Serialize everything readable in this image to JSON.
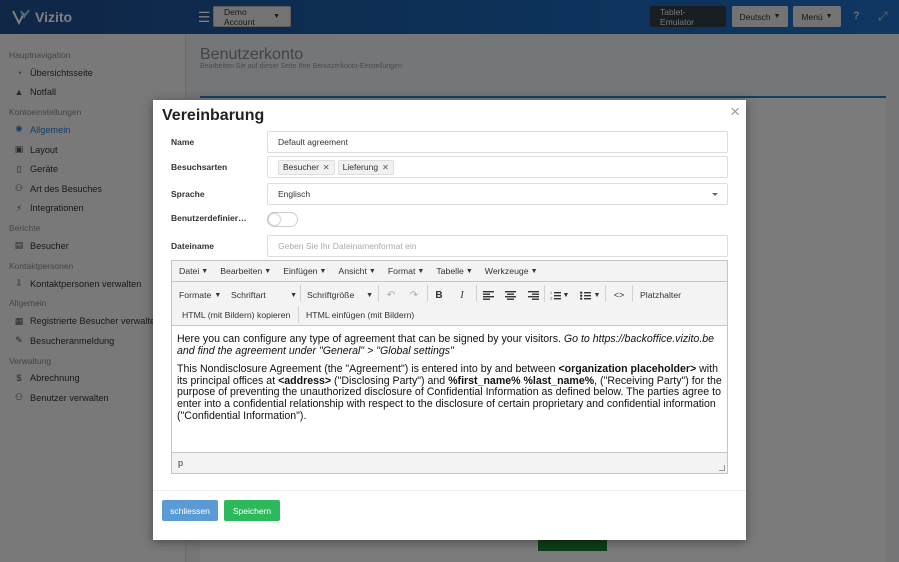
{
  "app": {
    "brand": "Vizito",
    "brand_icon": "vizito-logo-icon",
    "accent_color": "#1b64b5"
  },
  "topbar": {
    "account_label": "Demo Account",
    "tablet_label": "Tablet-Emulator",
    "language_label": "Deutsch",
    "menu_label": "Menü"
  },
  "sidebar": {
    "sections": [
      {
        "title": "Hauptnavigation",
        "items": [
          {
            "label": "Übersichtsseite",
            "icon": "dashboard-icon",
            "glyph": "◔"
          },
          {
            "label": "Notfall",
            "icon": "warning-icon",
            "glyph": "▲"
          }
        ]
      },
      {
        "title": "Kontoeinstellungen",
        "items": [
          {
            "label": "Allgemein",
            "icon": "settings-icon",
            "glyph": "✺",
            "active": true
          },
          {
            "label": "Layout",
            "icon": "image-icon",
            "glyph": "▣"
          },
          {
            "label": "Geräte",
            "icon": "tablet-icon",
            "glyph": "▯"
          },
          {
            "label": "Art des Besuches",
            "icon": "users-icon",
            "glyph": "⚇"
          },
          {
            "label": "Integrationen",
            "icon": "plug-icon",
            "glyph": "⚡"
          }
        ]
      },
      {
        "title": "Berichte",
        "items": [
          {
            "label": "Besucher",
            "icon": "report-icon",
            "glyph": "▤"
          }
        ]
      },
      {
        "title": "Kontaktpersonen",
        "items": [
          {
            "label": "Kontaktpersonen verwalten",
            "icon": "contacts-icon",
            "glyph": "⇩"
          }
        ]
      },
      {
        "title": "Allgemein",
        "items": [
          {
            "label": "Registrierte Besucher verwalten",
            "icon": "address-book-icon",
            "glyph": "▦"
          },
          {
            "label": "Besucheranmeldung",
            "icon": "signin-icon",
            "glyph": "✎"
          }
        ]
      },
      {
        "title": "Verwaltung",
        "items": [
          {
            "label": "Abrechnung",
            "icon": "dollar-icon",
            "glyph": "$"
          },
          {
            "label": "Benutzer verwalten",
            "icon": "user-plus-icon",
            "glyph": "⚇"
          }
        ]
      }
    ]
  },
  "page": {
    "title": "Benutzerkonto",
    "subtitle": "Bearbeiten Sie auf dieser Seite Ihre Benutzerkonto-Einstellungen"
  },
  "modal": {
    "title": "Vereinbarung",
    "close_glyph": "×",
    "fields": {
      "name_label": "Name",
      "name_value": "Default agreement",
      "visit_types_label": "Besuchsarten",
      "visit_types": [
        "Besucher",
        "Lieferung"
      ],
      "language_label": "Sprache",
      "language_value": "Englisch",
      "custom_label": "Benutzerdefinier…",
      "custom_enabled": false,
      "filename_label": "Dateiname",
      "filename_placeholder": "Geben Sie Ihr Dateinamenformat ein"
    },
    "editor": {
      "menus": [
        "Datei",
        "Bearbeiten",
        "Einfügen",
        "Ansicht",
        "Format",
        "Tabelle",
        "Werkzeuge"
      ],
      "toolbar": {
        "formats": "Formate",
        "font": "Schriftart",
        "font_size": "Schriftgröße",
        "placeholder": "Platzhalter",
        "copy_html": "HTML (mit Bildern) kopieren",
        "paste_html": "HTML einfügen (mit Bildern)"
      },
      "content": {
        "p1_text": "Here you can configure any type of agreement that can be signed by your visitors. ",
        "p1_italic": "Go to https://backoffice.vizito.be and find the agreement under \"General\" > \"Global settings\"",
        "p2_a": "This Nondisclosure Agreement (the \"Agreement\") is entered into by and between ",
        "p2_b": "<organization placeholder>",
        "p2_c": " with its principal offices at ",
        "p2_d": "<address>",
        "p2_e": " (\"Disclosing Party\") and ",
        "p2_f": "%first_name% %last_name%",
        "p2_g": ", (\"Receiving Party\") for the purpose of preventing the unauthorized disclosure of Confidential Information as defined below. The parties agree to enter into a confidential relationship with respect to the disclosure of certain proprietary and confidential information (\"Confidential Information\")."
      },
      "status_path": "p"
    },
    "buttons": {
      "close_label": "schliessen",
      "save_label": "Speichern"
    }
  }
}
